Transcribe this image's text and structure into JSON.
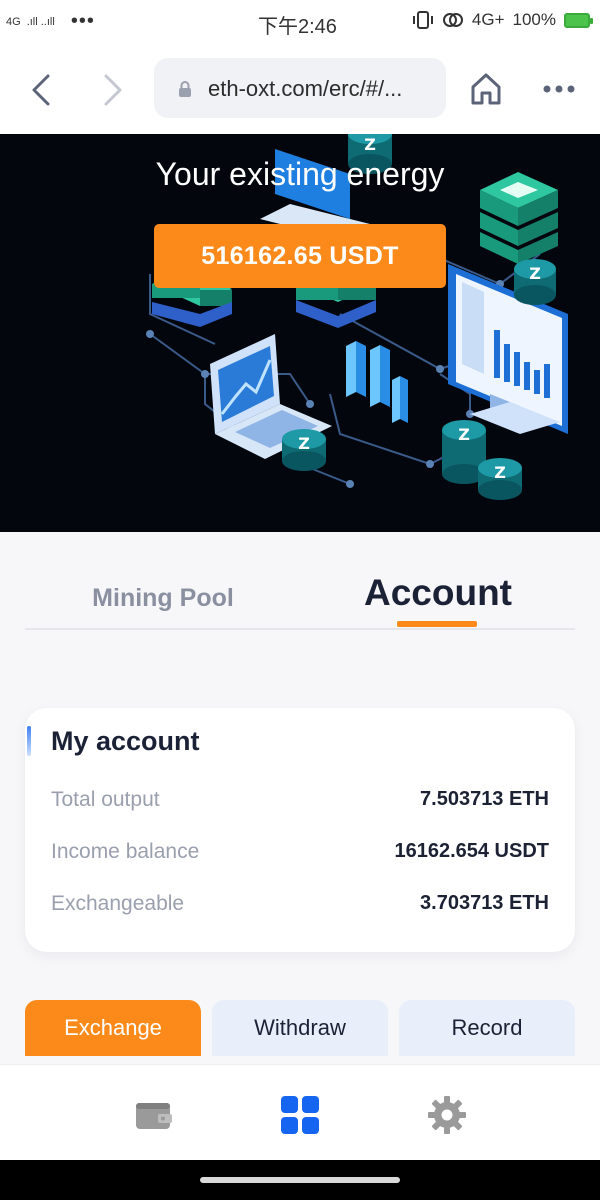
{
  "status_bar": {
    "network_left": "4G",
    "signal_text": ".ıll ..ıll",
    "dots": "•••",
    "time": "下午2:46",
    "network_right": "4G+",
    "battery": "100%"
  },
  "browser": {
    "url": "eth-oxt.com/erc/#/...",
    "icons": [
      "back-icon",
      "forward-icon",
      "lock-icon",
      "home-icon",
      "more-icon"
    ]
  },
  "hero": {
    "title": "Your existing energy",
    "energy_value": "516162.65 USDT",
    "coin_letter": "Z"
  },
  "tabs": {
    "mining_pool": "Mining Pool",
    "account": "Account",
    "active": "account"
  },
  "my_account": {
    "title": "My account",
    "rows": [
      {
        "label": "Total output",
        "value": "7.503713 ETH"
      },
      {
        "label": "Income balance",
        "value": "16162.654 USDT"
      },
      {
        "label": "Exchangeable",
        "value": "3.703713 ETH"
      }
    ]
  },
  "actions": {
    "exchange": "Exchange",
    "withdraw": "Withdraw",
    "record": "Record",
    "active": "exchange"
  },
  "bottom_nav": {
    "items": [
      "wallet-icon",
      "grid-icon",
      "gear-icon"
    ],
    "active": "grid-icon"
  },
  "colors": {
    "accent": "#fb8a1a",
    "active_nav": "#1565f0",
    "hero_bg": "#03070d"
  }
}
